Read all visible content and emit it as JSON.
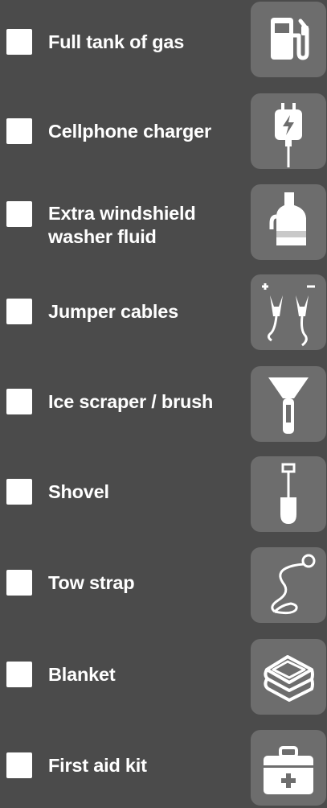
{
  "checklist": {
    "items": [
      {
        "label": "Full tank of gas",
        "icon": "gas-pump-icon",
        "checked": false
      },
      {
        "label": "Cellphone charger",
        "icon": "phone-charger-icon",
        "checked": false
      },
      {
        "label": "Extra windshield washer fluid",
        "icon": "washer-fluid-jug-icon",
        "checked": false
      },
      {
        "label": "Jumper cables",
        "icon": "jumper-cables-icon",
        "checked": false
      },
      {
        "label": "Ice scraper / brush",
        "icon": "ice-scraper-icon",
        "checked": false
      },
      {
        "label": "Shovel",
        "icon": "shovel-icon",
        "checked": false
      },
      {
        "label": "Tow strap",
        "icon": "tow-strap-icon",
        "checked": false
      },
      {
        "label": "Blanket",
        "icon": "blanket-icon",
        "checked": false
      },
      {
        "label": "First aid kit",
        "icon": "first-aid-kit-icon",
        "checked": false
      }
    ]
  },
  "colors": {
    "background": "#4b4b4b",
    "tile": "#6d6d6d",
    "icon": "#ffffff",
    "checkbox": "#ffffff",
    "text": "#ffffff"
  }
}
